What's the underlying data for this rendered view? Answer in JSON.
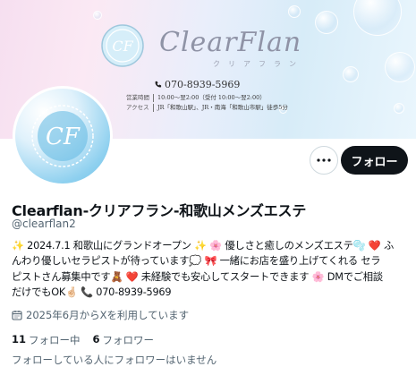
{
  "banner": {
    "brand_name": "ClearFlan",
    "brand_kana": "クリアフラン",
    "emblem_text": "CF",
    "phone": "070-8939-5969",
    "hours_label": "営業時間",
    "hours": "10:00～翌2:00（受付 10:00～翌2:00）",
    "access_label": "アクセス",
    "access": "JR「和歌山駅」、JR・南海「和歌山市駅」徒歩5分"
  },
  "profile": {
    "avatar_text": "CF",
    "display_name": "Clearflan-クリアフラン-和歌山メンズエステ",
    "handle": "@clearflan2",
    "bio_lines": [
      "✨ 2024.7.1 和歌山にグランドオープン ✨ 🌸 優しさと癒しのメンズエステ🫧 ❤️ ふ",
      "んわり優しいセラピストが待っています💭 🎀 一緒にお店を盛り上げてくれる セラ",
      "ピストさん募集中です🧸 ❤️ 未経験でも安心してスタートできます 🌸 DMでご相談",
      "だけでもOK🤞🏻 📞 070-8939-5969"
    ],
    "joined": "2025年6月からXを利用しています",
    "following_count": "11",
    "following_label": "フォロー中",
    "followers_count": "6",
    "followers_label": "フォロワー",
    "followers_note": "フォローしている人にフォロワーはいません"
  },
  "actions": {
    "follow_label": "フォロー"
  },
  "colors": {
    "primary_text": "#0f1419",
    "secondary_text": "#536471",
    "button_dark": "#0f1419",
    "border": "#cfd9de"
  }
}
